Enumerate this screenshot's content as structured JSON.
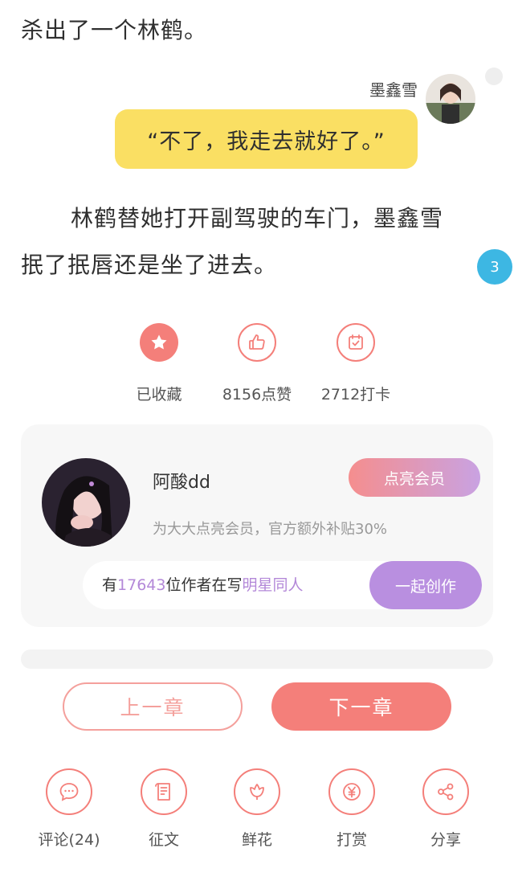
{
  "story": {
    "line_top": "杀出了一个林鹤。",
    "speaker": "墨鑫雪",
    "dialogue": "“不了，我走去就好了。”",
    "para_line1": "林鹤替她打开副驾驶的车门，墨鑫雪",
    "para_line2": "抿了抿唇还是坐了进去。",
    "comment_count_badge": "3"
  },
  "stats": {
    "collect_label": "已收藏",
    "like_label": "8156点赞",
    "checkin_label": "2712打卡"
  },
  "promo": {
    "username": "阿酸dd",
    "vip_button": "点亮会员",
    "subtitle": "为大大点亮会员，官方额外补贴30%",
    "creator_prefix": "有",
    "creator_count": "17643",
    "creator_middle": "位作者在写",
    "creator_topic": "明星同人",
    "create_button": "一起创作"
  },
  "chapter_nav": {
    "prev": "上一章",
    "next": "下一章"
  },
  "actions": {
    "comment": "评论(24)",
    "essay": "征文",
    "flower": "鲜花",
    "reward": "打赏",
    "share": "分享"
  },
  "colors": {
    "accent": "#f47f7a",
    "bubble": "#fadf63",
    "badge": "#3db7e3",
    "purple": "#b98fe0"
  }
}
